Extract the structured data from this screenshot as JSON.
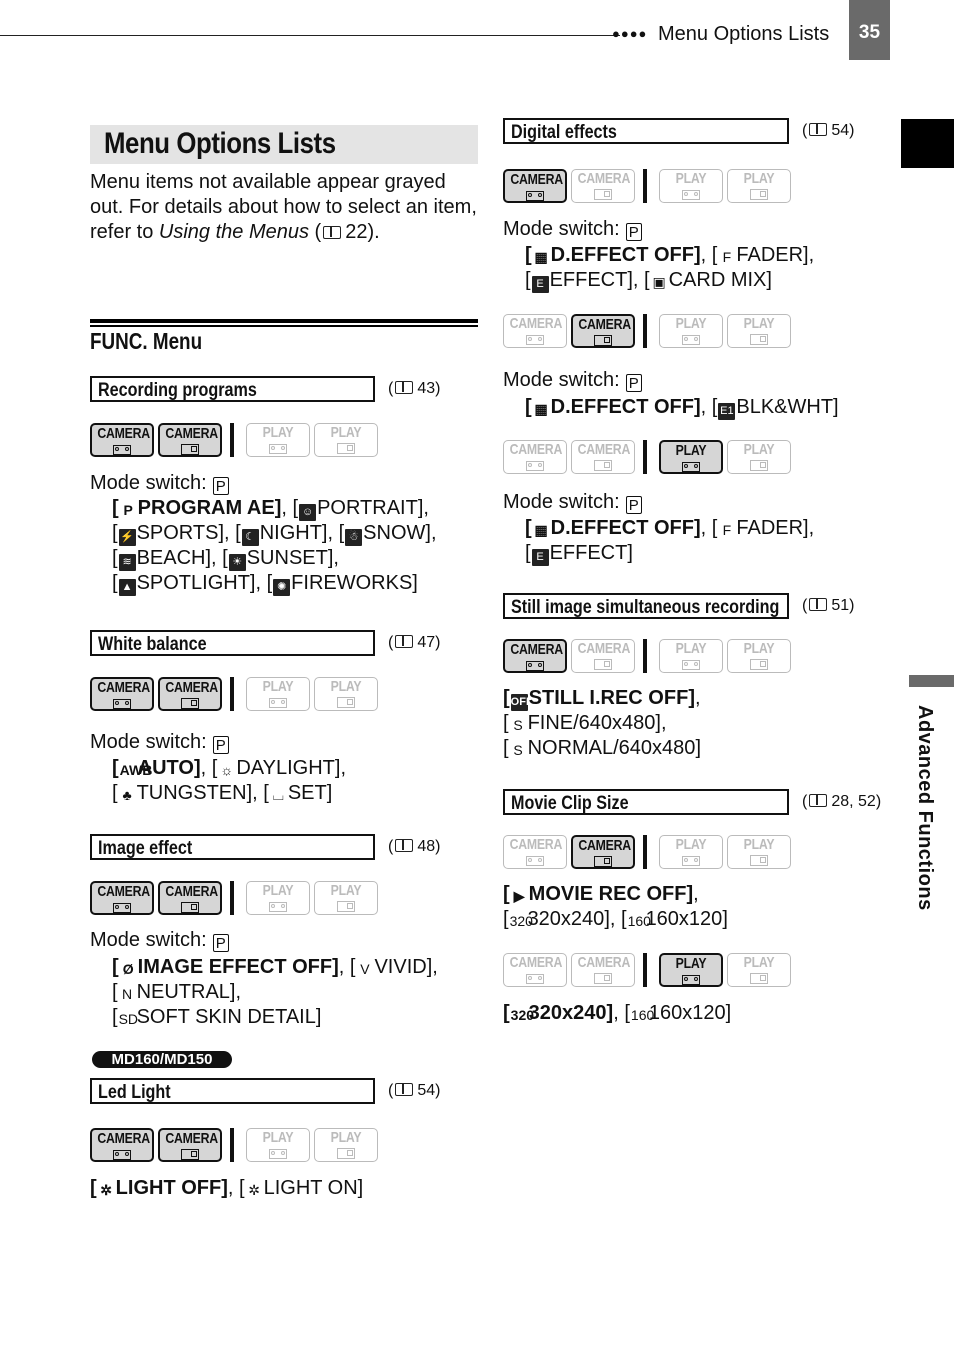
{
  "header": {
    "section_title": "Menu Options Lists",
    "page_number": "35",
    "dots": "●●●●"
  },
  "side_tab": {
    "label": "Advanced Functions"
  },
  "title": "Menu Options Lists",
  "intro": {
    "text_before": "Menu items not available appear grayed out. For details about how to select an item, refer to ",
    "link": "Using the Menus",
    "ref_open": " (",
    "ref_page": "22",
    "ref_close": ")."
  },
  "func_menu": "FUNC. Menu",
  "mode_labels": {
    "camera": "CAMERA",
    "play": "PLAY"
  },
  "mode_switch_label": "Mode switch:",
  "mode_switch_value": "P",
  "model_badge": "MD160/MD150",
  "sections": {
    "recording_programs": {
      "title": "Recording programs",
      "ref": "43",
      "modes_active": [
        "camera-tape",
        "camera-card"
      ],
      "options": [
        "PROGRAM AE",
        "PORTRAIT",
        "SPORTS",
        "NIGHT",
        "SNOW",
        "BEACH",
        "SUNSET",
        "SPOTLIGHT",
        "FIREWORKS"
      ]
    },
    "white_balance": {
      "title": "White balance",
      "ref": "47",
      "modes_active": [
        "camera-tape",
        "camera-card"
      ],
      "options": [
        "AUTO",
        "DAYLIGHT",
        "TUNGSTEN",
        "SET"
      ]
    },
    "image_effect": {
      "title": "Image effect",
      "ref": "48",
      "modes_active": [
        "camera-tape",
        "camera-card"
      ],
      "options": [
        "IMAGE EFFECT OFF",
        "VIVID",
        "NEUTRAL",
        "SOFT SKIN DETAIL"
      ]
    },
    "led_light": {
      "title": "Led Light",
      "ref": "54",
      "modes_active": [
        "camera-tape",
        "camera-card"
      ],
      "options": [
        "LIGHT OFF",
        "LIGHT ON"
      ]
    },
    "digital_effects": {
      "title": "Digital effects",
      "ref": "54",
      "groups": [
        {
          "modes_active": [
            "camera-tape"
          ],
          "options": [
            "D.EFFECT OFF",
            "FADER",
            "EFFECT",
            "CARD MIX"
          ]
        },
        {
          "modes_active": [
            "camera-card"
          ],
          "options": [
            "D.EFFECT OFF",
            "BLK&WHT"
          ]
        },
        {
          "modes_active": [
            "play-tape"
          ],
          "options": [
            "D.EFFECT OFF",
            "FADER",
            "EFFECT"
          ]
        }
      ]
    },
    "still_simul": {
      "title": "Still image simultaneous recording",
      "ref": "51",
      "modes_active": [
        "camera-tape"
      ],
      "options": [
        "STILL I.REC OFF",
        "FINE/640x480",
        "NORMAL/640x480"
      ]
    },
    "movie_clip": {
      "title": "Movie Clip Size",
      "ref": "28, 52",
      "groups": [
        {
          "modes_active": [
            "camera-card"
          ],
          "options": [
            "MOVIE REC OFF",
            "320x240",
            "160x120"
          ]
        },
        {
          "modes_active": [
            "play-tape"
          ],
          "options": [
            "320x240",
            "160x120"
          ]
        }
      ]
    }
  },
  "icons": {
    "p": "P",
    "portrait": "☺",
    "sports": "⚡",
    "night": "☾",
    "snow": "☃",
    "beach": "≋",
    "sunset": "☀",
    "spotlight": "▲",
    "fireworks": "✺",
    "awb": "AWB",
    "daylight": "☼",
    "tungsten": "♣",
    "set": "⌴",
    "ie_off": "Ø",
    "vivid": "V",
    "neutral": "N",
    "sd": "SD",
    "light_off": "✲",
    "light_on": "✲",
    "deff": "▦",
    "fader": "F",
    "effect": "E",
    "cardmix": "▣",
    "bw": "E1",
    "still_off": "OFF",
    "fine": "S",
    "normal": "S",
    "movie_off": "▶",
    "s320": "320",
    "s160": "160",
    "cam": "▶"
  }
}
